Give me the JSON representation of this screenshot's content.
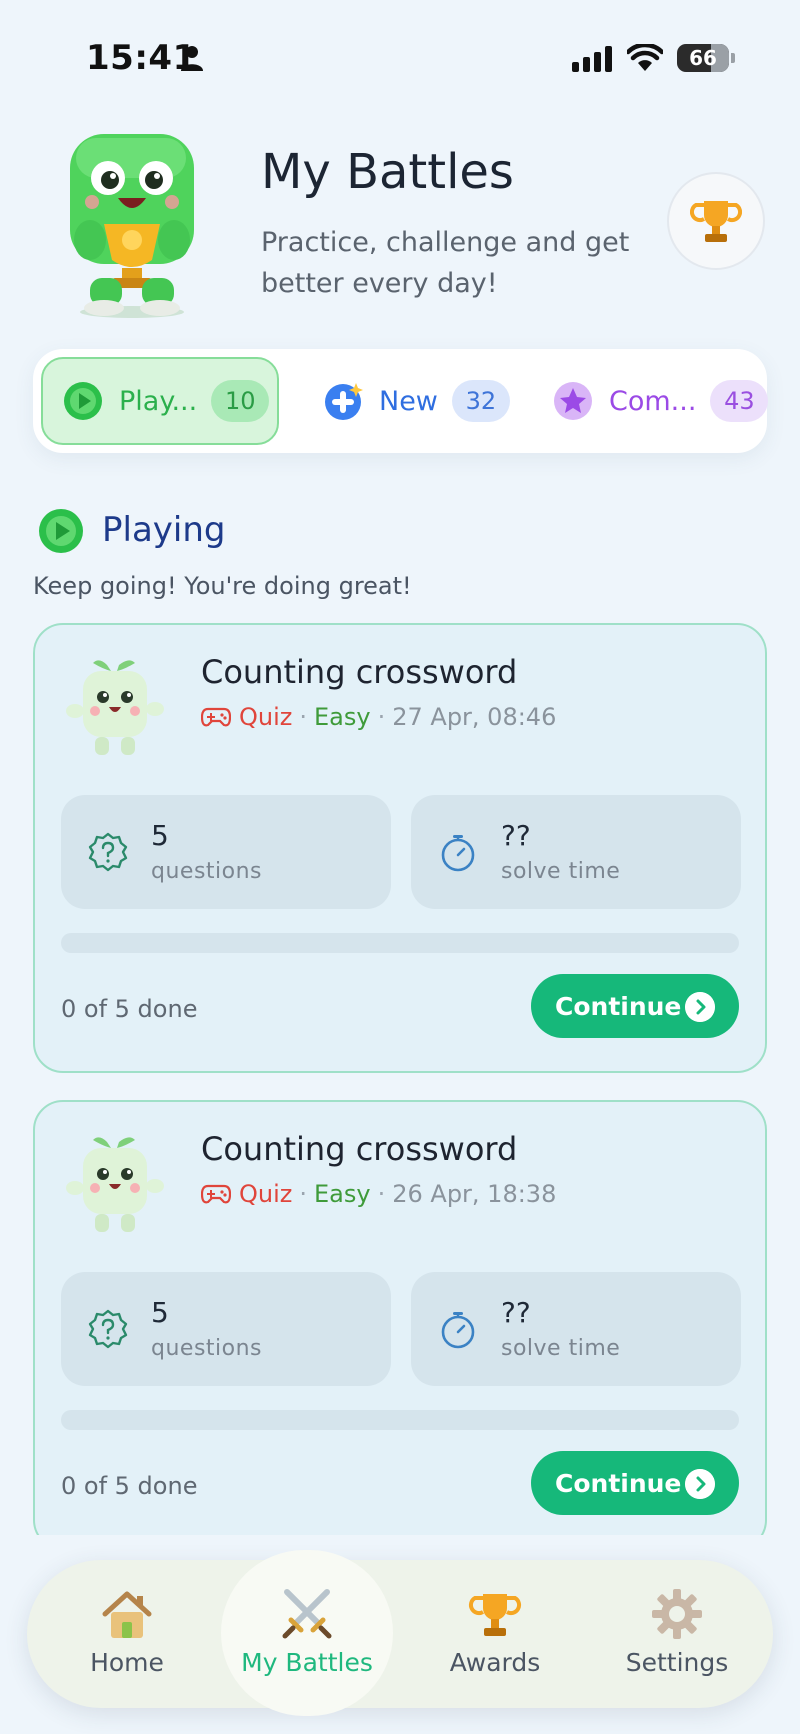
{
  "status_bar": {
    "time": "15:41",
    "battery": "66",
    "battery_level": 0.66
  },
  "header": {
    "title": "My Battles",
    "subtitle": "Practice, challenge and get better every day!",
    "trophy_icon": "trophy-icon"
  },
  "tabs": [
    {
      "label": "Play...",
      "count": "10",
      "icon": "play-icon",
      "active": true
    },
    {
      "label": "New",
      "count": "32",
      "icon": "plus-icon",
      "active": false
    },
    {
      "label": "Com...",
      "count": "43",
      "icon": "star-icon",
      "active": false
    }
  ],
  "section": {
    "title": "Playing",
    "subtitle": "Keep going! You're doing great!",
    "icon": "play-icon"
  },
  "cards": [
    {
      "title": "Counting crossword",
      "type": "Quiz",
      "level": "Easy",
      "date": "27 Apr, 08:46",
      "separator": "·",
      "questions_value": "5",
      "questions_label": "questions",
      "time_value": "??",
      "time_label": "solve time",
      "progress_text": "0 of 5 done",
      "progress": 0,
      "button": "Continue"
    },
    {
      "title": "Counting crossword",
      "type": "Quiz",
      "level": "Easy",
      "date": "26 Apr, 18:38",
      "separator": "·",
      "questions_value": "5",
      "questions_label": "questions",
      "time_value": "??",
      "time_label": "solve time",
      "progress_text": "0 of 5 done",
      "progress": 0,
      "button": "Continue"
    }
  ],
  "nav": [
    {
      "label": "Home",
      "icon": "house-icon",
      "active": false
    },
    {
      "label": "My Battles",
      "icon": "crossed-swords-icon",
      "active": true
    },
    {
      "label": "Awards",
      "icon": "trophy-icon",
      "active": false
    },
    {
      "label": "Settings",
      "icon": "gear-icon",
      "active": false
    }
  ],
  "colors": {
    "background": "#eef5fb",
    "accent_green": "#16b87a",
    "playing_green": "#2bb04c",
    "new_blue": "#2f6ee0",
    "completed_purple": "#9b4ae6",
    "quiz_red": "#e0453b",
    "easy_green": "#3f9b3a"
  }
}
